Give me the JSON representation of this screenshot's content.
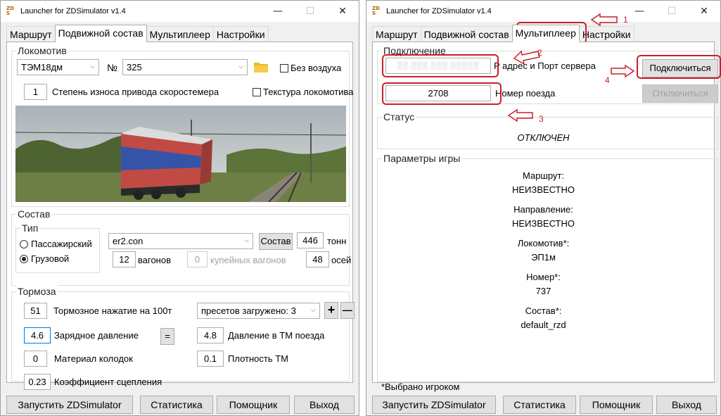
{
  "title": "Launcher for ZDSimulator v1.4",
  "tabs": [
    "Маршрут",
    "Подвижной состав",
    "Мультиплеер",
    "Настройки"
  ],
  "left": {
    "locomotive": {
      "section_title": "Локомотив",
      "model": "ТЭМ18дм",
      "number_label": "№",
      "number": "325",
      "no_air_label": "Без воздуха",
      "wear_value": "1",
      "wear_label": "Степень износа привода скоростемера",
      "texture_label": "Текстура локомотива"
    },
    "consist": {
      "section_title": "Состав",
      "type_title": "Тип",
      "passenger_label": "Пассажирский",
      "freight_label": "Грузовой",
      "file": "er2.con",
      "consist_button": "Состав",
      "tons_value": "446",
      "tons_label": "тонн",
      "wagons_value": "12",
      "wagons_label": "вагонов",
      "compartment_value": "0",
      "compartment_label": "купейных вагонов",
      "axles_value": "48",
      "axles_label": "осей"
    },
    "brakes": {
      "section_title": "Тормоза",
      "pressure_value": "51",
      "pressure_label": "Тормозное нажатие на 100т",
      "presets": "пресетов загружено: 3",
      "plus": "+",
      "minus": "—",
      "charge_value": "4.6",
      "charge_label": "Зарядное давление",
      "equals": "=",
      "tm_pressure_value": "4.8",
      "tm_pressure_label": "Давление в ТМ поезда",
      "pad_value": "0",
      "pad_label": "Материал колодок",
      "density_value": "0.1",
      "density_label": "Плотность ТМ",
      "adhesion_value": "0.23",
      "adhesion_label": "Коэффициент сцепления"
    }
  },
  "right": {
    "connection": {
      "section_title": "Подключение",
      "server_label": "P адрес и Порт сервера",
      "connect_button": "Подключиться",
      "train_value": "2708",
      "train_label": "Номер поезда",
      "disconnect_button": "Отключиться"
    },
    "status": {
      "section_title": "Статус",
      "value": "ОТКЛЮЧЕН"
    },
    "game_params": {
      "section_title": "Параметры игры",
      "route_label": "Маршрут:",
      "route_value": "НЕИЗВЕСТНО",
      "direction_label": "Направление:",
      "direction_value": "НЕИЗВЕСТНО",
      "loco_label": "Локомотив*:",
      "loco_value": "ЭП1м",
      "number_label": "Номер*:",
      "number_value": "737",
      "consist_label": "Состав*:",
      "consist_value": "default_rzd",
      "footnote": "*Выбрано игроком"
    },
    "annotations": [
      "1",
      "2",
      "3",
      "4"
    ]
  },
  "bottom": {
    "launch": "Запустить ZDSimulator",
    "stats": "Статистика",
    "helper": "Помощник",
    "exit": "Выход"
  },
  "colors": {
    "accent_red": "#c9202a",
    "focus_blue": "#0078d7"
  }
}
